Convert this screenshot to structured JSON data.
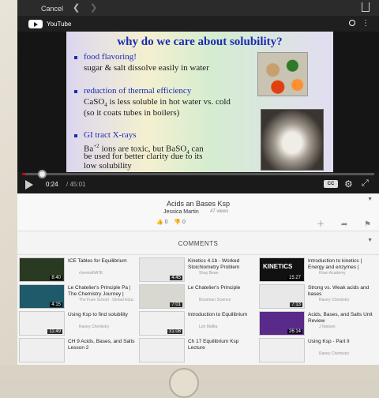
{
  "browser": {
    "cancel_label": "Cancel",
    "back_icon": "chevron-left-icon",
    "forward_icon": "chevron-right-icon",
    "share_icon": "share-icon"
  },
  "app": {
    "name": "YouTube"
  },
  "slide": {
    "title": "why do we care about solubility?",
    "bullets": [
      {
        "head": "food flavoring!",
        "body": "sugar & salt dissolve easily in water"
      },
      {
        "head": "reduction of thermal efficiency",
        "body1": "CaSO",
        "body1_sub": "4",
        "body1_rest": " is less soluble in hot water vs. cold",
        "body2": "(so it coats tubes in boilers)"
      },
      {
        "head": "GI tract X-rays",
        "body1": "Ba",
        "body1_sup": "+2",
        "body1_rest": " ions are toxic, but BaSO",
        "body1_sub": "4",
        "body1_end": " can",
        "body2": "be used for better clarity due to its",
        "body3": "low solubility"
      }
    ]
  },
  "player": {
    "current_time": "0:24",
    "duration": "/ 45:01",
    "progress": 0.009,
    "cc_label": "CC"
  },
  "video": {
    "title": "Acids an Bases Ksp",
    "channel": "Jessica Martin",
    "views": "47 views",
    "likes": "0",
    "dislikes": "0"
  },
  "comments": {
    "label": "COMMENTS"
  },
  "related": [
    {
      "title": "ICE Tables for Equilibrium",
      "channel": "chemistNATE",
      "duration": "8:40",
      "thumb_color": "#2a3a22"
    },
    {
      "title": "Kinetics 4.1b - Worked Stoichiometry Problem",
      "channel": "Shay Bean",
      "duration": "4:45",
      "thumb_color": "#e6e6e6"
    },
    {
      "title": "Introduction to kinetics | Energy and enzymes |",
      "channel": "Khan Academy",
      "duration": "15:27",
      "thumb_color": "#111111",
      "overlay": "KINETICS"
    },
    {
      "title": "Le Chatelier's Principle Pa | The Chemistry Journey |",
      "channel": "The Fuse School · Global Educ",
      "duration": "4:15",
      "thumb_color": "#1e5a6a"
    },
    {
      "title": "Le Chatelier's Principle",
      "channel": "Bozeman Science",
      "duration": "7:01",
      "thumb_color": "#d8d8d0"
    },
    {
      "title": "Strong vs. Weak acids and bases",
      "channel": "Raney Chemistry",
      "duration": "7:13",
      "thumb_color": "#e8e8e8"
    },
    {
      "title": "Using Ksp to find solubility",
      "channel": "Raney Chemistry",
      "duration": "11:49",
      "thumb_color": "#efefef"
    },
    {
      "title": "Introduction to Equilibrium",
      "channel": "Lori Maffia",
      "duration": "31:08",
      "thumb_color": "#f0f0f0"
    },
    {
      "title": "Acids, Bases, and Salts Unit Review",
      "channel": "J Nielsen",
      "duration": "26:14",
      "thumb_color": "#5a2a8a"
    },
    {
      "title": "CH 9 Acids, Bases, and Salts Lesson 2",
      "channel": "",
      "duration": "",
      "thumb_color": "#efefef"
    },
    {
      "title": "Ch 17 Equilibrium Ksp Lecture",
      "channel": "",
      "duration": "",
      "thumb_color": "#efefef"
    },
    {
      "title": "Using Ksp - Part II",
      "channel": "Raney Chemistry",
      "duration": "",
      "thumb_color": "#efefef"
    }
  ]
}
